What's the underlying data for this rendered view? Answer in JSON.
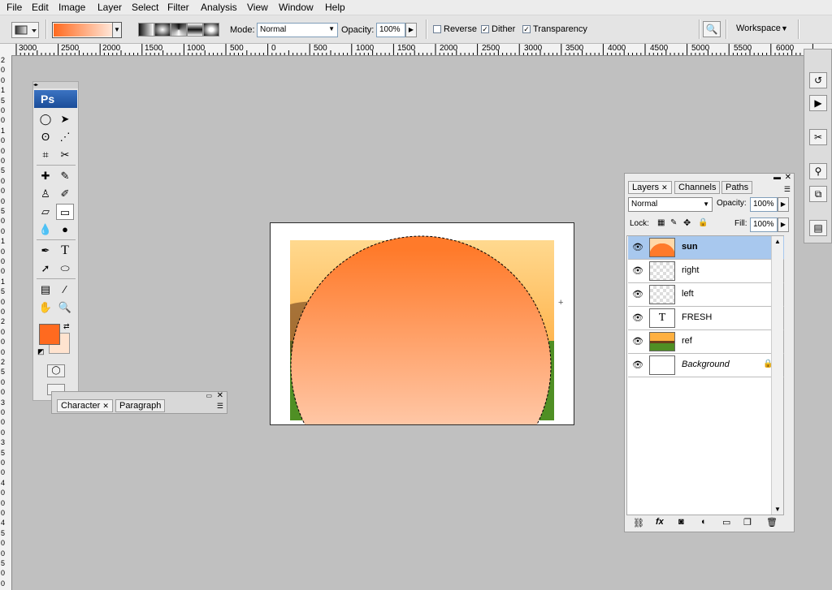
{
  "menu": {
    "items": [
      "File",
      "Edit",
      "Image",
      "Layer",
      "Select",
      "Filter",
      "Analysis",
      "View",
      "Window",
      "Help"
    ]
  },
  "options": {
    "mode_label": "Mode:",
    "mode_value": "Normal",
    "opacity_label": "Opacity:",
    "opacity_value": "100%",
    "reverse_label": "Reverse",
    "reverse_checked": false,
    "dither_label": "Dither",
    "dither_checked": true,
    "transparency_label": "Transparency",
    "transparency_checked": true,
    "workspace_label": "Workspace"
  },
  "ruler": {
    "h_ticks": [
      "3000",
      "2500",
      "2000",
      "1500",
      "1000",
      "500",
      "0",
      "500",
      "1000",
      "1500",
      "2000",
      "2500",
      "3000",
      "3500",
      "4000",
      "4500",
      "5000",
      "5500",
      "6000"
    ],
    "v_ticks": [
      "2",
      "0",
      "0",
      "1",
      "5",
      "0",
      "0",
      "1",
      "0",
      "0",
      "0",
      "5",
      "0",
      "0",
      "0",
      "5",
      "0",
      "0",
      "1",
      "0",
      "0",
      "0",
      "1",
      "5",
      "0",
      "0",
      "2",
      "0",
      "0",
      "0",
      "2",
      "5",
      "0",
      "0",
      "3",
      "0",
      "0",
      "0",
      "3",
      "5",
      "0",
      "0",
      "4",
      "0",
      "0",
      "0",
      "4",
      "5",
      "0",
      "0",
      "5",
      "0",
      "0"
    ]
  },
  "toolbox": {
    "logo": "Ps",
    "foreground_color": "#ff6a1f",
    "background_color": "#ffe3cf"
  },
  "char_panel": {
    "tabs": [
      "Character",
      "Paragraph"
    ]
  },
  "canvas": {
    "sun_gradient_top": "#ff7a2a",
    "sun_gradient_bottom": "#ffe6d8",
    "sky_top": "#ffd98f",
    "sky_bottom": "#ff9a20",
    "grass": "#4f8f24"
  },
  "layers_panel": {
    "tabs": [
      "Layers",
      "Channels",
      "Paths"
    ],
    "blend_mode": "Normal",
    "opacity_label": "Opacity:",
    "opacity_value": "100%",
    "lock_label": "Lock:",
    "fill_label": "Fill:",
    "fill_value": "100%",
    "layers": [
      {
        "name": "sun",
        "selected": true
      },
      {
        "name": "right",
        "selected": false
      },
      {
        "name": "left",
        "selected": false
      },
      {
        "name": "FRESH",
        "selected": false
      },
      {
        "name": "ref",
        "selected": false
      },
      {
        "name": "Background",
        "selected": false
      }
    ],
    "selected_color": "#a8c8ee"
  }
}
